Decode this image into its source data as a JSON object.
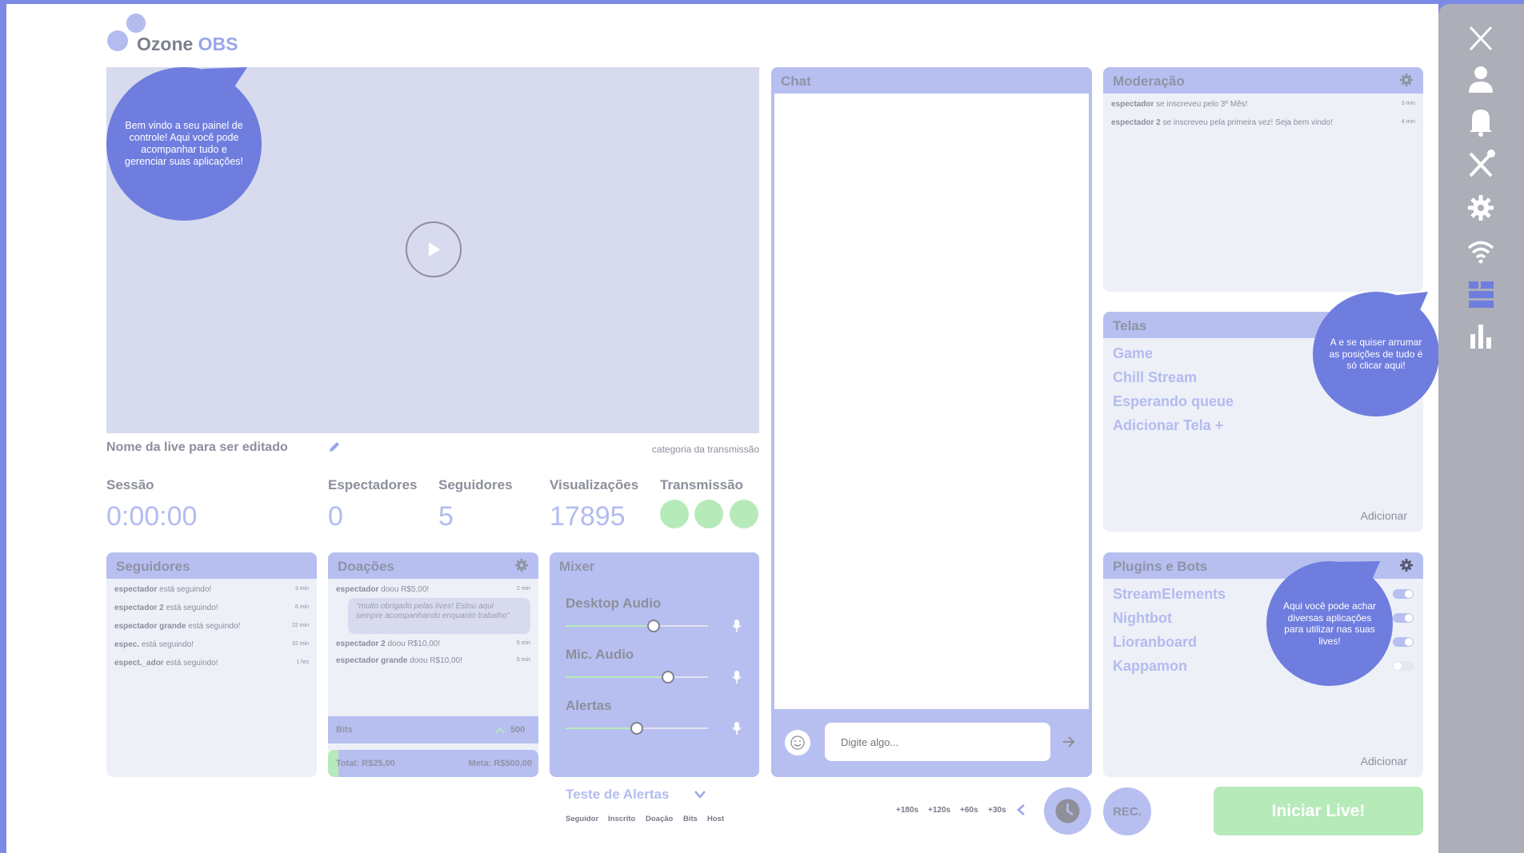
{
  "app": {
    "logo_main": "Ozone",
    "logo_accent": "OBS"
  },
  "colors": {
    "accent": "#6f7ddf",
    "panel_header": "#b7bff0",
    "panel_bg": "#eef0f8",
    "green": "#b6eab9"
  },
  "welcome_bubble": "Bem vindo a seu painel de controle! Aqui você pode acompanhar tudo e gerenciar suas aplicações!",
  "stream": {
    "title": "Nome da live para ser editado",
    "category": "categoria  da transmissão"
  },
  "stats": {
    "session_label": "Sessão",
    "session_value": "0:00:00",
    "viewers_label": "Espectadores",
    "viewers_value": "0",
    "followers_label": "Seguidores",
    "followers_value": "5",
    "views_label": "Visualizações",
    "views_value": "17895",
    "transmission_label": "Transmissão"
  },
  "followers_panel": {
    "title": "Seguidores",
    "items": [
      {
        "user": "espectador",
        "text": "está seguindo!",
        "time": "3 min"
      },
      {
        "user": "espectador 2",
        "text": "está seguindo!",
        "time": "6 min"
      },
      {
        "user": "espectador grande",
        "text": "está seguindo!",
        "time": "22 min"
      },
      {
        "user": "espec.",
        "text": "está seguindo!",
        "time": "32 min"
      },
      {
        "user": "espect._ador",
        "text": "está seguindo!",
        "time": "1 hrs"
      }
    ]
  },
  "donations_panel": {
    "title": "Doações",
    "items": [
      {
        "user": "espectador",
        "text": "doou R$5,00!",
        "time": "2 min"
      },
      {
        "user": "espectador 2",
        "text": "doou R$10,00!",
        "time": "5 min"
      },
      {
        "user": "espectador grande",
        "text": "doou R$10,00!",
        "time": "5 min"
      }
    ],
    "message": "\"muito obrigado pelas lives! Estou aqui sempre acompanhando enquanto trabalho\"",
    "bits_label": "Bits",
    "bits_value": "500",
    "total": "Total: R$25,00",
    "goal": "Meta: R$500,00",
    "progress": 0.05
  },
  "mixer": {
    "title": "Mixer",
    "channels": [
      {
        "name": "Desktop Audio",
        "level": 0.62
      },
      {
        "name": "Mic. Audio",
        "level": 0.72
      },
      {
        "name": "Alertas",
        "level": 0.5
      }
    ]
  },
  "alerts": {
    "title": "Teste de Alertas",
    "tabs": [
      "Seguidor",
      "Inscrito",
      "Doação",
      "Bits",
      "Host"
    ]
  },
  "chat": {
    "title": "Chat",
    "placeholder": "Digite algo..."
  },
  "moderation": {
    "title": "Moderação",
    "items": [
      {
        "user": "espectador",
        "text": "se inscreveu pelo 3º Mês!",
        "time": "3 min"
      },
      {
        "user": "espectador 2",
        "text": "se inscreveu pela primeira vez! Seja bem vindo!",
        "time": "4 min"
      }
    ]
  },
  "screens": {
    "title": "Telas",
    "items": [
      "Game",
      "Chill Stream",
      "Esperando queue",
      "Adicionar Tela +"
    ],
    "add": "Adicionar"
  },
  "screens_bubble": "A e se quiser arrumar as posições de tudo é só clicar aqui!",
  "plugins": {
    "title": "Plugins e Bots",
    "items": [
      {
        "name": "StreamElements",
        "on": true
      },
      {
        "name": "Nightbot",
        "on": true
      },
      {
        "name": "Lioranboard",
        "on": true
      },
      {
        "name": "Kappamon",
        "on": false
      }
    ],
    "add": "Adicionar"
  },
  "plugins_bubble": "Aqui você pode achar diversas aplicações para utilizar nas suas lives!",
  "bottom": {
    "timers": [
      "+180s",
      "+120s",
      "+60s",
      "+30s"
    ],
    "rec": "REC.",
    "start": "Iniciar Live!"
  }
}
